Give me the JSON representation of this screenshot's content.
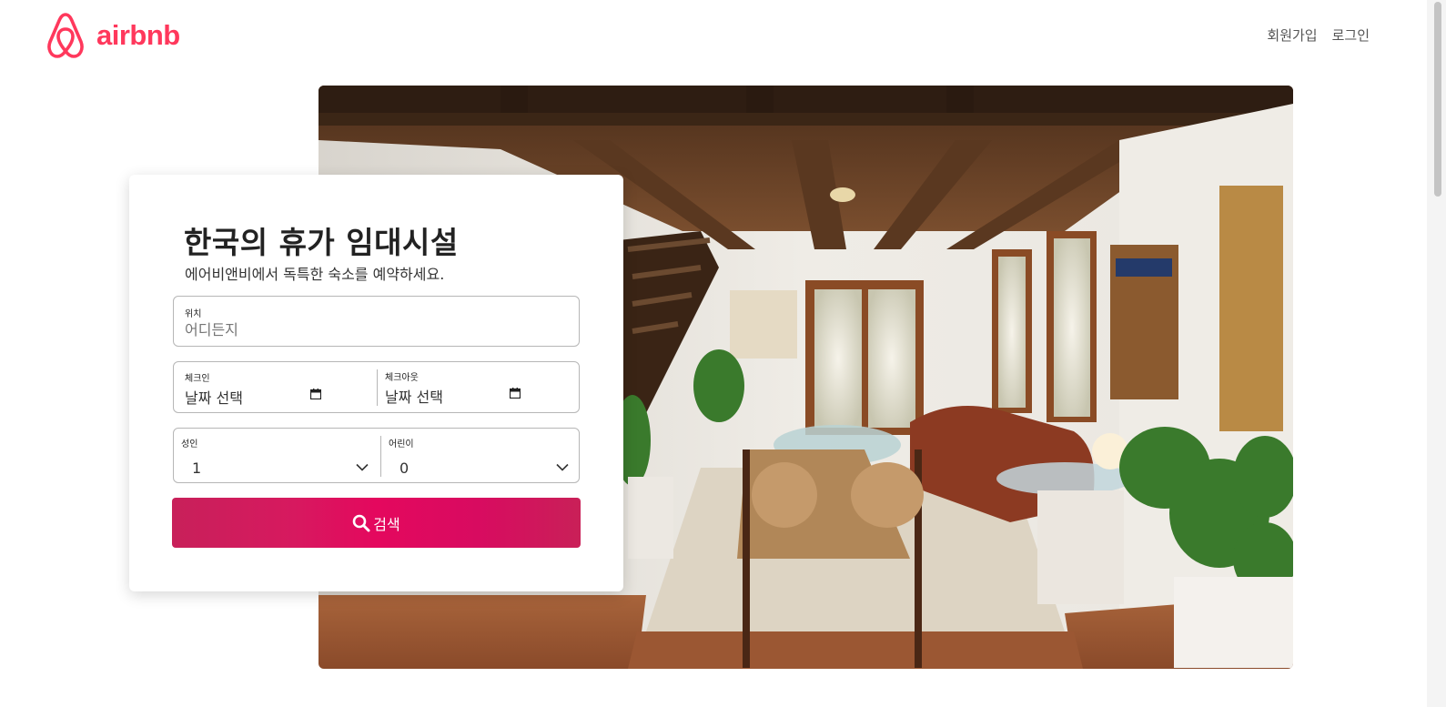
{
  "header": {
    "logo_text": "airbnb",
    "logo_icon": "airbnb-belo-icon",
    "nav": {
      "signup": "회원가입",
      "login": "로그인"
    }
  },
  "hero": {
    "image": "living-room-interior-photo"
  },
  "search_card": {
    "title": "한국의 휴가 임대시설",
    "subtitle": "에어비앤비에서 독특한 숙소를 예약하세요.",
    "location": {
      "label": "위치",
      "placeholder": "어디든지"
    },
    "checkin": {
      "label": "체크인",
      "value": "날짜 선택"
    },
    "checkout": {
      "label": "체크아웃",
      "value": "날짜 선택"
    },
    "adults": {
      "label": "성인",
      "value": "1"
    },
    "children": {
      "label": "어린이",
      "value": "0"
    },
    "search_button": "검색"
  },
  "colors": {
    "brand": "#ff385c",
    "button_gradient": [
      "#c8205a",
      "#e4085e",
      "#c92058"
    ]
  }
}
